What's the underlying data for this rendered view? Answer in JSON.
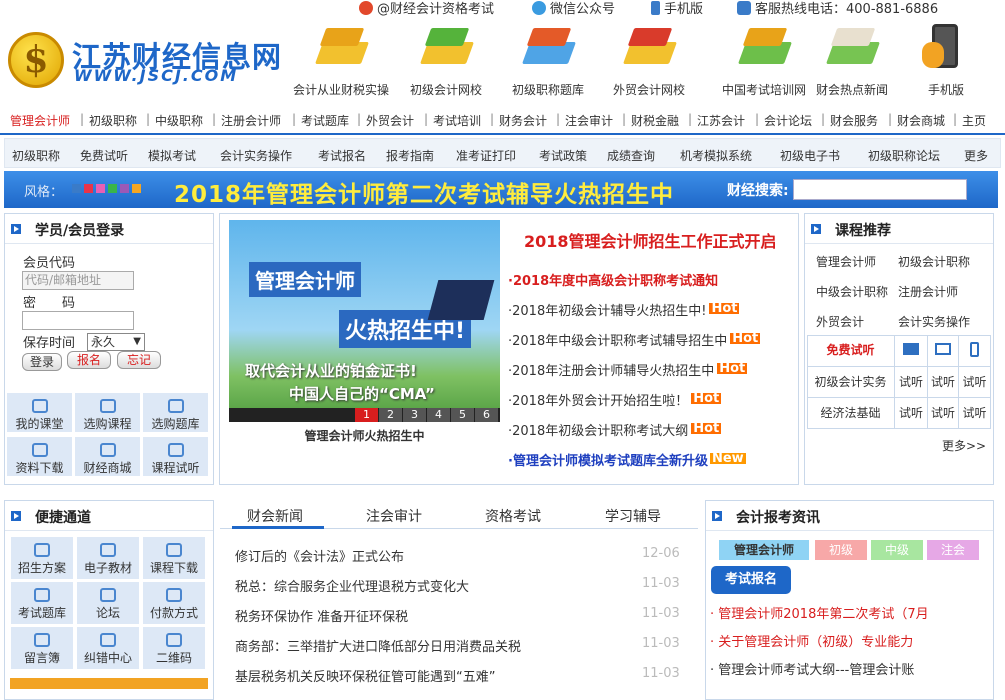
{
  "topbar": {
    "weibo": "@财经会计资格考试",
    "wechat": "微信公众号",
    "mobile": "手机版",
    "hotline": "客服热线电话：400-881-6886"
  },
  "logo": {
    "title": "江苏财经信息网",
    "url_text": "WWW.JSCJ.COM",
    "coin": "$"
  },
  "features": [
    {
      "label": "会计从业财税实操",
      "icon": "pencil-book-icon",
      "c1": "#f2c12e",
      "c2": "#e8a319"
    },
    {
      "label": "初级会计网校",
      "icon": "palm-book-icon",
      "c1": "#f2c12e",
      "c2": "#55b33b"
    },
    {
      "label": "初级职称题库",
      "icon": "chart-book-icon",
      "c1": "#4fa4e6",
      "c2": "#e45a28"
    },
    {
      "label": "外贸会计网校",
      "icon": "alert-book-icon",
      "c1": "#f2c12e",
      "c2": "#d93b2b"
    },
    {
      "label": "中国考试培训网",
      "icon": "notebook-icon",
      "c1": "#6dbf4a",
      "c2": "#e8a319"
    },
    {
      "label": "财会热点新闻",
      "icon": "coffee-book-icon",
      "c1": "#77c452",
      "c2": "#e8e0cf"
    },
    {
      "label": "手机版",
      "icon": "phone-hand-icon",
      "c1": "#f2a323",
      "c2": "#555555"
    }
  ],
  "nav1": [
    "管理会计师",
    "初级职称",
    "中级职称",
    "注册会计师",
    "考试题库",
    "外贸会计",
    "考试培训",
    "财务会计",
    "注会审计",
    "财税金融",
    "江苏会计",
    "会计论坛",
    "财会服务",
    "财会商城",
    "主页"
  ],
  "nav2": [
    "初级职称",
    "免费试听",
    "模拟考试",
    "会计实务操作",
    "考试报名",
    "报考指南",
    "准考证打印",
    "考试政策",
    "成绩查询",
    "机考模拟系统",
    "初级电子书",
    "初级职称论坛",
    "更多"
  ],
  "banner": {
    "style_label": "风格：",
    "headline": "2018年管理会计师第二次考试辅导火热招生中",
    "search_label": "财经搜索:",
    "swatches": [
      "#3a7bc8",
      "#e8344a",
      "#e85fb4",
      "#39b54a",
      "#9b59b6",
      "#f5a623"
    ]
  },
  "login": {
    "title": "学员/会员登录",
    "user_label": "会员代码",
    "user_placeholder": "代码/邮箱地址",
    "pwd_label": "密　　码",
    "keep_label": "保存时间",
    "keep_value": "永久",
    "login_btn": "登录",
    "signup_btn": "报名",
    "forgot_btn": "忘记",
    "shortcuts": [
      "我的课堂",
      "选购课程",
      "选购题库",
      "资料下载",
      "财经商城",
      "课程试听"
    ]
  },
  "slide": {
    "line1": "管理会计师",
    "line2": "火热招生中!",
    "line3": "取代会计从业的铂金证书!",
    "line4": "中国人自己的“CMA”",
    "pages": [
      "1",
      "2",
      "3",
      "4",
      "5",
      "6"
    ],
    "caption": "管理会计师火热招生中"
  },
  "headnews": {
    "title": "2018管理会计师招生工作正式开启",
    "items": [
      {
        "text": "·2018年度中高级会计职称考试通知",
        "badge": "",
        "color": "#d81e1e"
      },
      {
        "text": "·2018年初级会计辅导火热招生中!",
        "badge": "Hot",
        "color": "#333333"
      },
      {
        "text": "·2018年中级会计职称考试辅导招生中",
        "badge": "Hot",
        "color": "#333333"
      },
      {
        "text": "·2018年注册会计师辅导火热招生中",
        "badge": "Hot",
        "color": "#333333"
      },
      {
        "text": "·2018年外贸会计开始招生啦！",
        "badge": "Hot",
        "color": "#333333"
      },
      {
        "text": "·2018年初级会计职称考试大纲",
        "badge": "Hot",
        "color": "#333333"
      },
      {
        "text": "·管理会计师模拟考试题库全新升级",
        "badge": "New",
        "color": "#1e3fbf"
      }
    ]
  },
  "courses": {
    "title": "课程推荐",
    "links": [
      "管理会计师",
      "初级会计职称",
      "中级会计职称",
      "注册会计师",
      "外贸会计",
      "会计实务操作"
    ],
    "free": "免费试听",
    "rows": [
      {
        "name": "初级会计实务",
        "a": "试听",
        "b": "试听",
        "c": "试听"
      },
      {
        "name": "经济法基础",
        "a": "试听",
        "b": "试听",
        "c": "试听"
      }
    ],
    "more": "更多>>"
  },
  "quick": {
    "title": "便捷通道",
    "items": [
      "招生方案",
      "电子教材",
      "课程下载",
      "考试题库",
      "论坛",
      "付款方式",
      "留言簿",
      "纠错中心",
      "二维码"
    ]
  },
  "tabs": [
    "财会新闻",
    "注会审计",
    "资格考试",
    "学习辅导"
  ],
  "newslist": [
    {
      "title": "修订后的《会计法》正式公布",
      "date": "12-06"
    },
    {
      "title": "税总：综合服务企业代理退税方式变化大",
      "date": "11-03"
    },
    {
      "title": "税务环保协作 准备开征环保税",
      "date": "11-03"
    },
    {
      "title": "商务部：三举措扩大进口降低部分日用消费品关税",
      "date": "11-03"
    },
    {
      "title": "基层税务机关反映环保税征管可能遇到“五难”",
      "date": "11-03"
    }
  ],
  "exam": {
    "title": "会计报考资讯",
    "pills": [
      {
        "label": "管理会计师",
        "bg": "#8fd3f4"
      },
      {
        "label": "初级",
        "bg": "#f7a8a8"
      },
      {
        "label": "中级",
        "bg": "#a8e6a0"
      },
      {
        "label": "注会",
        "bg": "#e6a8e6"
      }
    ],
    "button": "考试报名",
    "items": [
      "· 管理会计师2018年第二次考试（7月",
      "· 关于管理会计师（初级）专业能力",
      "· 管理会计师考试大纲---管理会计账"
    ]
  }
}
